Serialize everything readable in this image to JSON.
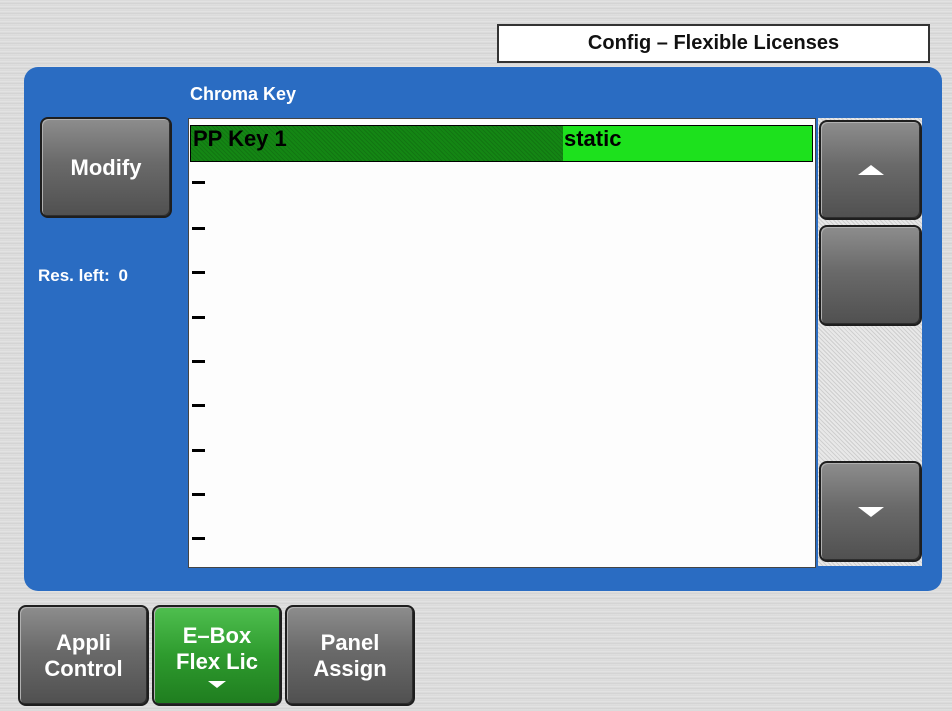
{
  "header": {
    "title": "Config – Flexible Licenses"
  },
  "list": {
    "title": "Chroma Key",
    "selected_row": {
      "name": "PP Key 1",
      "status": "static"
    },
    "empty_rows": [
      "–",
      "–",
      "–",
      "–",
      "–",
      "–",
      "–",
      "–",
      "–"
    ]
  },
  "side": {
    "modify_label": "Modify",
    "res_label": "Res. left:",
    "res_value": "0"
  },
  "scroll": {
    "up_icon": "arrow-up-icon",
    "down_icon": "arrow-down-icon"
  },
  "tabs": [
    {
      "line1": "Appli",
      "line2": "Control",
      "active": false
    },
    {
      "line1": "E–Box",
      "line2": "Flex Lic",
      "active": true
    },
    {
      "line1": "Panel",
      "line2": "Assign",
      "active": false
    }
  ],
  "colors": {
    "panel": "#2a6cc2",
    "selected_dark": "#148614",
    "selected_bright": "#1de11d",
    "active_tab": "#2e9b2e"
  }
}
